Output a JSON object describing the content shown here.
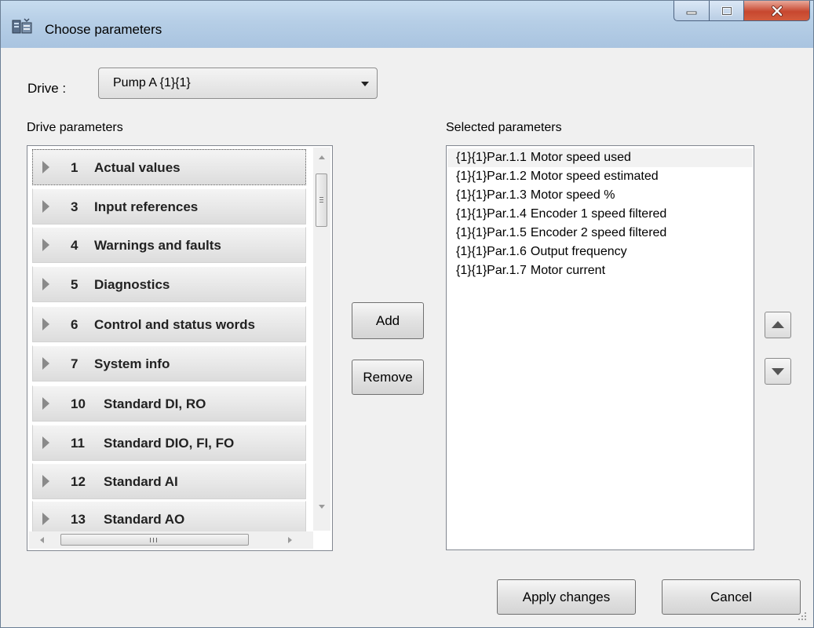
{
  "window": {
    "title": "Choose parameters"
  },
  "drive": {
    "label": "Drive :",
    "selected": "Pump A {1}{1}"
  },
  "drive_parameters": {
    "label": "Drive parameters",
    "groups": [
      {
        "number": "1",
        "name": "Actual values"
      },
      {
        "number": "3",
        "name": "Input references"
      },
      {
        "number": "4",
        "name": "Warnings and faults"
      },
      {
        "number": "5",
        "name": "Diagnostics"
      },
      {
        "number": "6",
        "name": "Control and status words"
      },
      {
        "number": "7",
        "name": "System info"
      },
      {
        "number": "10",
        "name": "Standard DI, RO"
      },
      {
        "number": "11",
        "name": "Standard DIO, FI, FO"
      },
      {
        "number": "12",
        "name": "Standard AI"
      },
      {
        "number": "13",
        "name": "Standard AO"
      }
    ]
  },
  "buttons": {
    "add": "Add",
    "remove": "Remove",
    "apply": "Apply changes",
    "cancel": "Cancel"
  },
  "selected_parameters": {
    "label": "Selected parameters",
    "items": [
      {
        "code": "{1}{1}Par.1.1",
        "name": "Motor speed used"
      },
      {
        "code": "{1}{1}Par.1.2",
        "name": "Motor speed estimated"
      },
      {
        "code": "{1}{1}Par.1.3",
        "name": "Motor speed %"
      },
      {
        "code": "{1}{1}Par.1.4",
        "name": "Encoder 1 speed filtered"
      },
      {
        "code": "{1}{1}Par.1.5",
        "name": "Encoder 2 speed filtered"
      },
      {
        "code": "{1}{1}Par.1.6",
        "name": "Output frequency"
      },
      {
        "code": "{1}{1}Par.1.7",
        "name": "Motor current"
      }
    ]
  },
  "icons": {
    "app": "app-icon",
    "minimize": "minimize-icon",
    "maximize": "maximize-icon",
    "close": "close-icon",
    "move_up": "arrow-up-icon",
    "move_down": "arrow-down-icon"
  }
}
